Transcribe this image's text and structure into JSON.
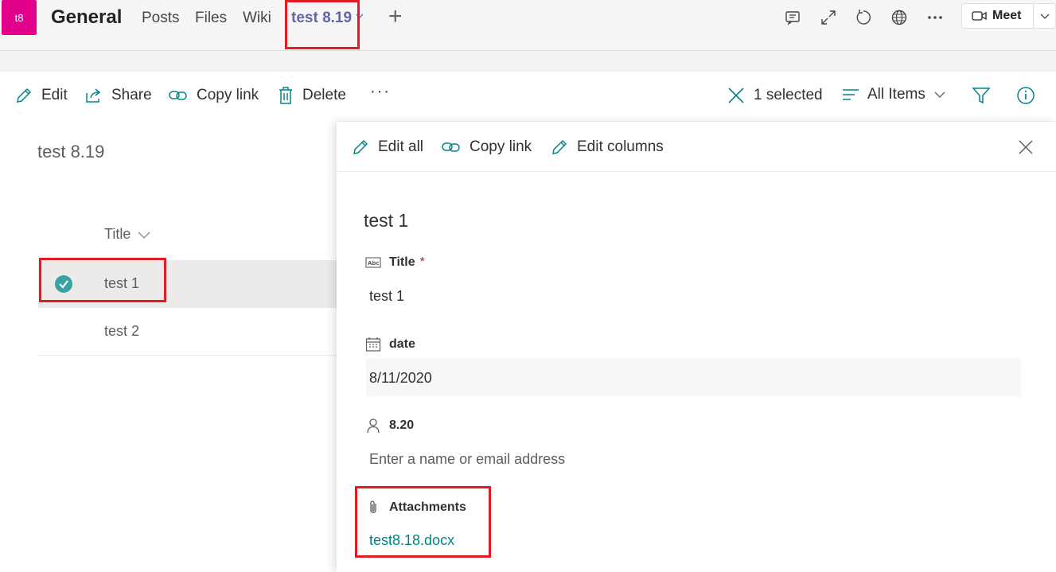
{
  "header": {
    "team_avatar": "t8",
    "channel": "General",
    "tabs": [
      "Posts",
      "Files",
      "Wiki"
    ],
    "active_tab": "test 8.19",
    "meet_label": "Meet",
    "icons": [
      "conversation-icon",
      "expand-icon",
      "refresh-icon",
      "globe-icon",
      "more-icon"
    ]
  },
  "commandbar": {
    "edit": "Edit",
    "share": "Share",
    "copy_link": "Copy link",
    "delete": "Delete",
    "more": "···",
    "selected": "1 selected",
    "view": "All Items"
  },
  "list": {
    "title": "test 8.19",
    "column": "Title",
    "rows": [
      "test 1",
      "test 2"
    ],
    "selected_row": 0
  },
  "panel": {
    "edit_all": "Edit all",
    "copy_link": "Copy link",
    "edit_columns": "Edit columns",
    "item_title": "test 1",
    "fields": {
      "title_label": "Title",
      "title_required": "*",
      "title_value": "test 1",
      "date_label": "date",
      "date_value": "8/11/2020",
      "person_label": "8.20",
      "person_placeholder": "Enter a name or email address",
      "attachments_label": "Attachments",
      "attachment_file": "test8.18.docx"
    }
  },
  "colors": {
    "teams_purple": "#6264a7",
    "avatar_magenta": "#e3008c",
    "sp_teal": "#038387",
    "check_teal": "#38a3a5",
    "highlight_red": "#e31c23"
  }
}
